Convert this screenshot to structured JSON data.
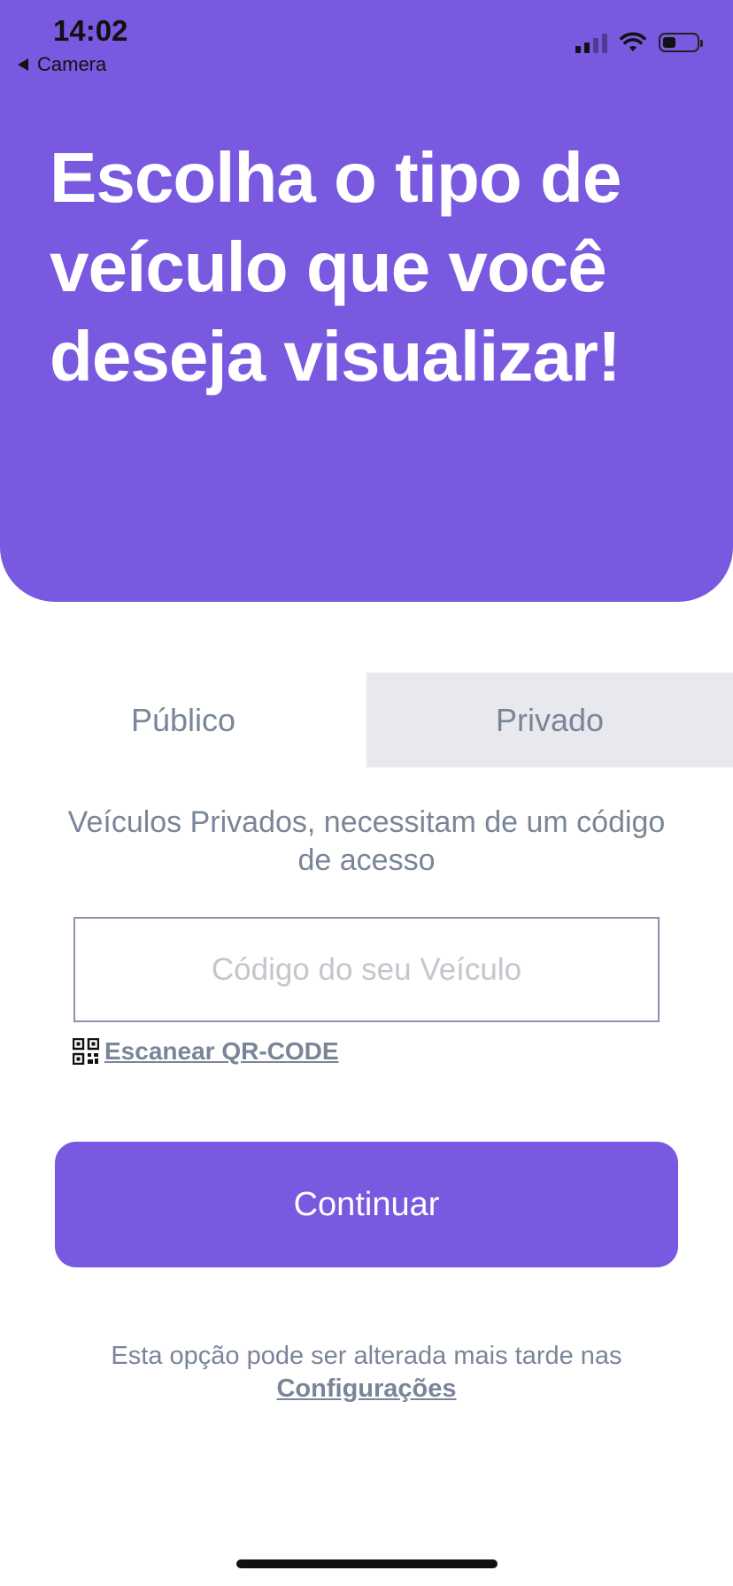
{
  "status_bar": {
    "time": "14:02",
    "back_app": "Camera",
    "icons": [
      "signal-icon",
      "wifi-icon",
      "battery-icon"
    ]
  },
  "header": {
    "title": "Escolha o tipo de veículo que você deseja visualizar!",
    "background_color": "#7859df"
  },
  "tabs": [
    {
      "label": "Público",
      "selected": false
    },
    {
      "label": "Privado",
      "selected": true
    }
  ],
  "info_text": "Veículos Privados, necessitam de um código de acesso",
  "code_field": {
    "placeholder": "Código do seu Veículo",
    "value": ""
  },
  "qr_link": {
    "label": "Escanear QR-CODE",
    "icon": "qr-code-icon"
  },
  "continue_button": {
    "label": "Continuar"
  },
  "footer": {
    "text": "Esta opção pode ser alterada mais tarde nas ",
    "link_label": "Configurações"
  }
}
